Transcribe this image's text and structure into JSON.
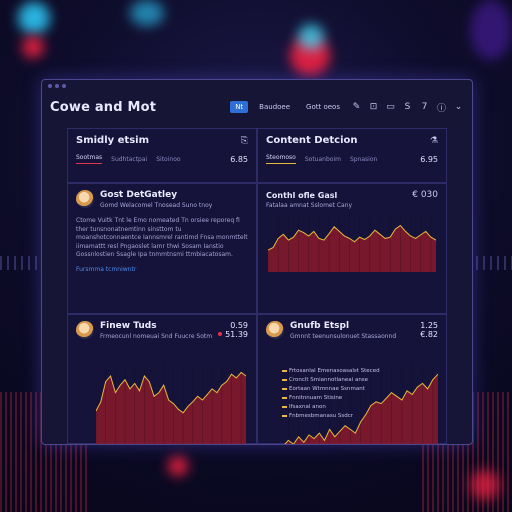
{
  "app": {
    "title": "Cowe and Mot"
  },
  "toolbar": {
    "buttons": [
      "Nt",
      "Baudoee",
      "Gott oeos"
    ],
    "icons": [
      "edit-icon",
      "folder-icon",
      "chat-icon",
      "s-icon",
      "t-icon",
      "info-icon",
      "chevron-down-icon"
    ],
    "icon_glyphs": {
      "s": "S",
      "t": "7"
    }
  },
  "panels": {
    "similarity": {
      "title": "Smidly etsim",
      "tabs": [
        "Sootmas",
        "Sudhtactpai",
        "Sitoinoo"
      ],
      "value": "6.85"
    },
    "content": {
      "title": "Content Detcion",
      "tabs": [
        "Steomoso",
        "Sotuanboim",
        "Spnasion"
      ],
      "value": "6.95"
    },
    "profile": {
      "name": "Gost DetGatley",
      "subtitle": "Gomd Welacomel Tnosead Suno tnoy",
      "body": "Ctome Vuitk Tnt le Emo nomeated Tn orsiee reporeq fi ther tunsnonatnemtinn sinsttom tu moanshotconnaentce Iannsmrel rantimd Fnsa monmttelt iimamattt resl Pngaoslet lamr thwi Sosam Ianstio Gossnlostien Ssagle Ipa tnmmtnsmi ttmbiacatosam.",
      "link": "Fursmma tcmniwntr"
    },
    "trend": {
      "title": "Conthl ofle Gasl",
      "subtitle": "Fatalaa amnat Sslomet Cany",
      "value": "€ 030"
    },
    "finder": {
      "name": "Finew Tuds",
      "subtitle": "Frmeocunl nomeuai Snd Fuucre Sotm",
      "value1": "0.59",
      "value2": "51.39"
    },
    "guide": {
      "name": "Gnufb Etspl",
      "subtitle": "Gmnnt teenunsulonuet Stassaonnd",
      "value1": "1.25",
      "value2": "€.82",
      "list": [
        "Frtosanlal Emenasoasalst Steced",
        "Cronclt Smiannotlaneai anse",
        "Eortaan Wtmnnae Ssnmant",
        "Fnnitnnuam Stisine",
        "Ifsaxnal anon",
        "Fnbmesbmanasu Ssdcr"
      ]
    }
  },
  "colors": {
    "accent": "#2d6fd6",
    "line": "#e8b93c",
    "fill": "#8a1a2c",
    "red": "#e0334a"
  },
  "chart_data": [
    {
      "type": "area",
      "name": "content-chart",
      "ylim": [
        0,
        100
      ],
      "values": [
        38,
        42,
        58,
        65,
        55,
        60,
        72,
        68,
        62,
        70,
        58,
        55,
        66,
        78,
        70,
        62,
        58,
        52,
        60,
        56,
        62,
        72,
        65,
        58,
        60,
        74,
        80,
        70,
        62,
        58,
        64,
        70,
        60,
        55
      ]
    },
    {
      "type": "area",
      "name": "finder-chart",
      "ylim": [
        0,
        100
      ],
      "values": [
        50,
        60,
        82,
        88,
        70,
        78,
        84,
        74,
        80,
        72,
        88,
        82,
        66,
        70,
        78,
        62,
        58,
        52,
        48,
        55,
        60,
        66,
        62,
        68,
        74,
        70,
        78,
        82,
        90,
        86,
        92,
        88
      ]
    },
    {
      "type": "area",
      "name": "guide-chart",
      "ylim": [
        0,
        100
      ],
      "values": [
        8,
        12,
        18,
        14,
        22,
        16,
        24,
        20,
        26,
        18,
        30,
        22,
        28,
        34,
        30,
        26,
        38,
        46,
        56,
        60,
        58,
        64,
        70,
        66,
        62,
        72,
        68,
        76,
        80,
        74,
        84,
        90
      ]
    }
  ]
}
